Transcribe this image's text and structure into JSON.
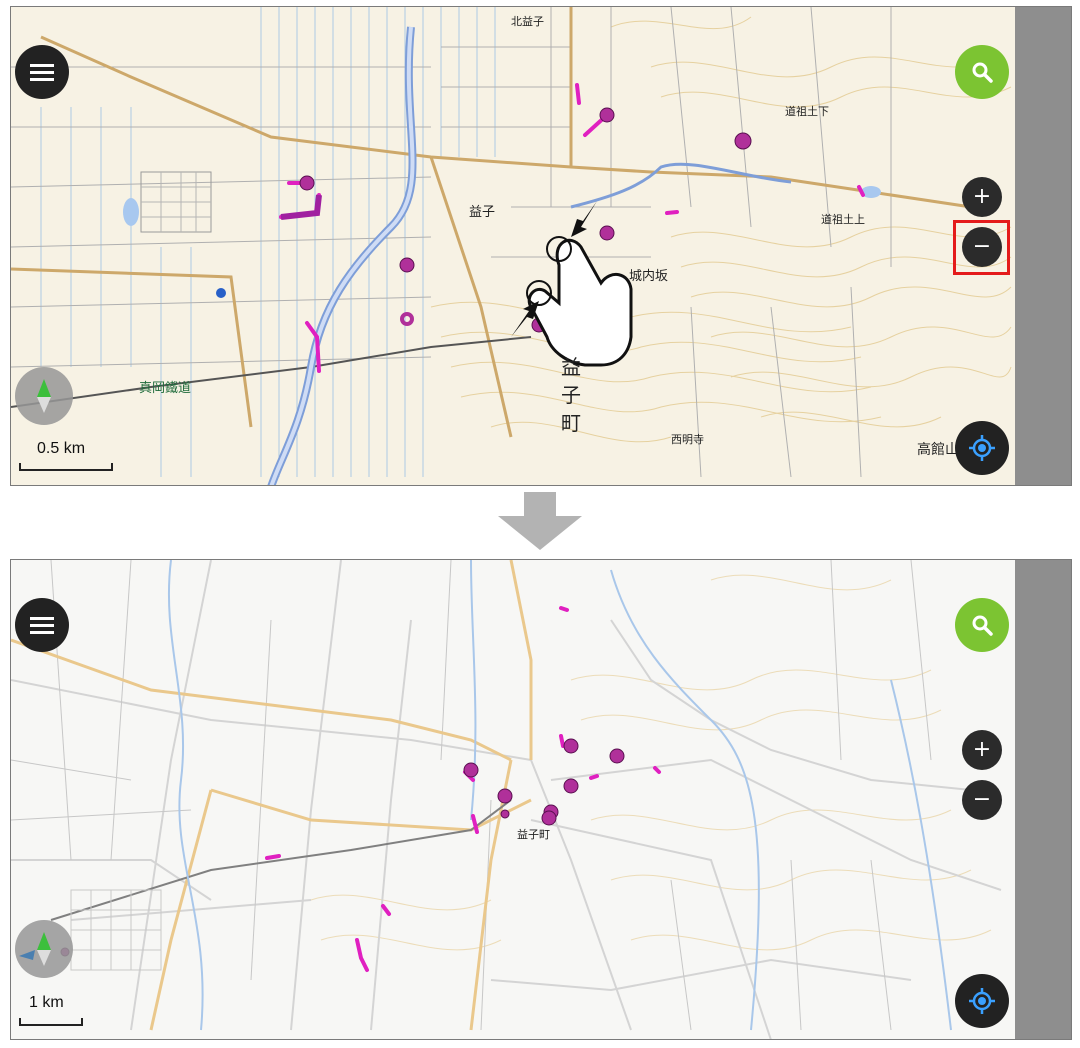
{
  "instruction_arrow": "down",
  "top_panel": {
    "scale_label": "0.5 km",
    "town_label_vertical": [
      "益",
      "子",
      "町"
    ],
    "place_labels": [
      {
        "text": "益子",
        "kind": "station"
      },
      {
        "text": "城内坂",
        "kind": "place"
      },
      {
        "text": "真岡鐵道",
        "kind": "railway"
      },
      {
        "text": "高館山",
        "kind": "mountain"
      },
      {
        "text": "道祖土下",
        "kind": "place"
      },
      {
        "text": "道祖土上",
        "kind": "place"
      },
      {
        "text": "北益子",
        "kind": "place"
      },
      {
        "text": "西明寺",
        "kind": "place"
      }
    ],
    "gesture": "pinch-in",
    "zoom_out_highlighted": true
  },
  "bottom_panel": {
    "scale_label": "1 km",
    "place_labels": [
      {
        "text": "益子町",
        "kind": "town"
      }
    ]
  },
  "controls": {
    "menu": "menu-icon",
    "search": "search-icon",
    "zoom_in": "+",
    "zoom_out": "−",
    "locate": "locate-icon"
  },
  "colors": {
    "fab_dark": "#222222",
    "fab_green": "#7cc432",
    "route_magenta": "#e020c0",
    "poi_purple": "#b0309a",
    "highlight_red": "#e41b1b",
    "locate_blue": "#3aa0ff"
  }
}
